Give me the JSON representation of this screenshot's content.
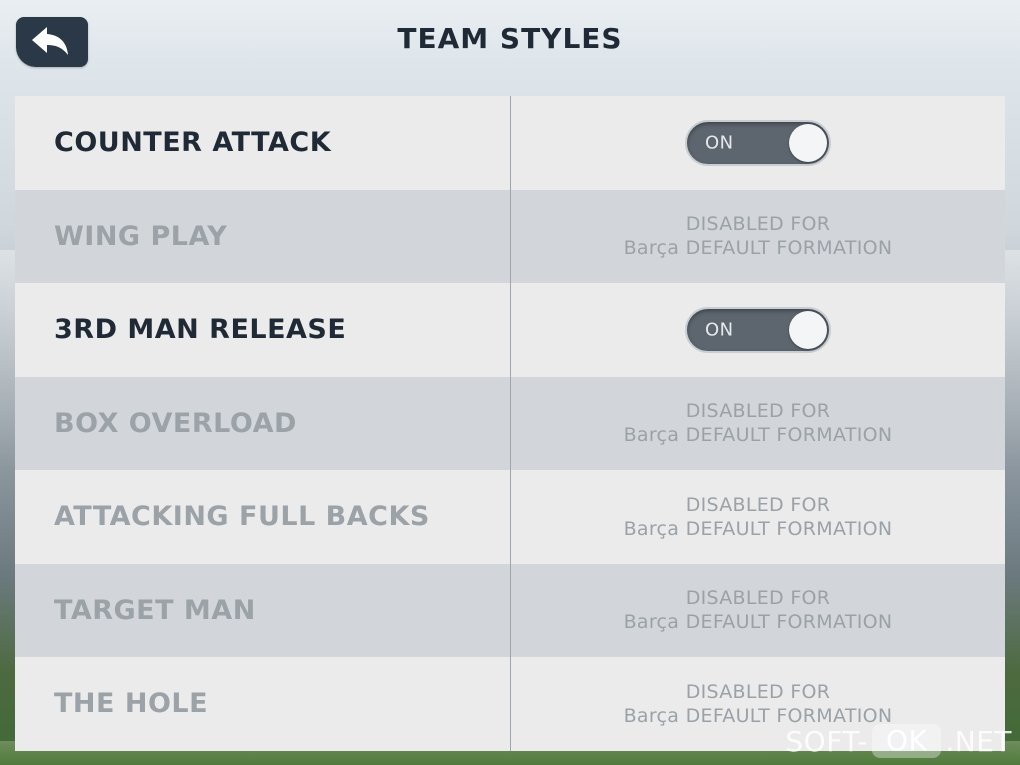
{
  "header": {
    "title": "TEAM STYLES",
    "back_icon": "back-arrow-icon"
  },
  "rows": [
    {
      "label": "COUNTER ATTACK",
      "enabled": true,
      "toggle": "ON",
      "state": "on"
    },
    {
      "label": "WING PLAY",
      "enabled": false,
      "disabled_line1": "DISABLED FOR",
      "disabled_line2": "Barça DEFAULT FORMATION"
    },
    {
      "label": "3RD MAN RELEASE",
      "enabled": true,
      "toggle": "ON",
      "state": "on"
    },
    {
      "label": "BOX OVERLOAD",
      "enabled": false,
      "disabled_line1": "DISABLED FOR",
      "disabled_line2": "Barça DEFAULT FORMATION"
    },
    {
      "label": "ATTACKING FULL BACKS",
      "enabled": false,
      "disabled_line1": "DISABLED FOR",
      "disabled_line2": "Barça DEFAULT FORMATION"
    },
    {
      "label": "TARGET MAN",
      "enabled": false,
      "disabled_line1": "DISABLED FOR",
      "disabled_line2": "Barça DEFAULT FORMATION"
    },
    {
      "label": "THE HOLE",
      "enabled": false,
      "disabled_line1": "DISABLED FOR",
      "disabled_line2": "Barça DEFAULT FORMATION"
    }
  ],
  "watermark": {
    "part1": "SOFT-",
    "part2": "OK",
    "part3": ".NET"
  },
  "colors": {
    "enabled_text": "#1f2a36",
    "disabled_text": "#9ba2a8",
    "row_light": "#ebebeb",
    "row_dark": "#d2d6da",
    "toggle_track": "#5d666f"
  }
}
